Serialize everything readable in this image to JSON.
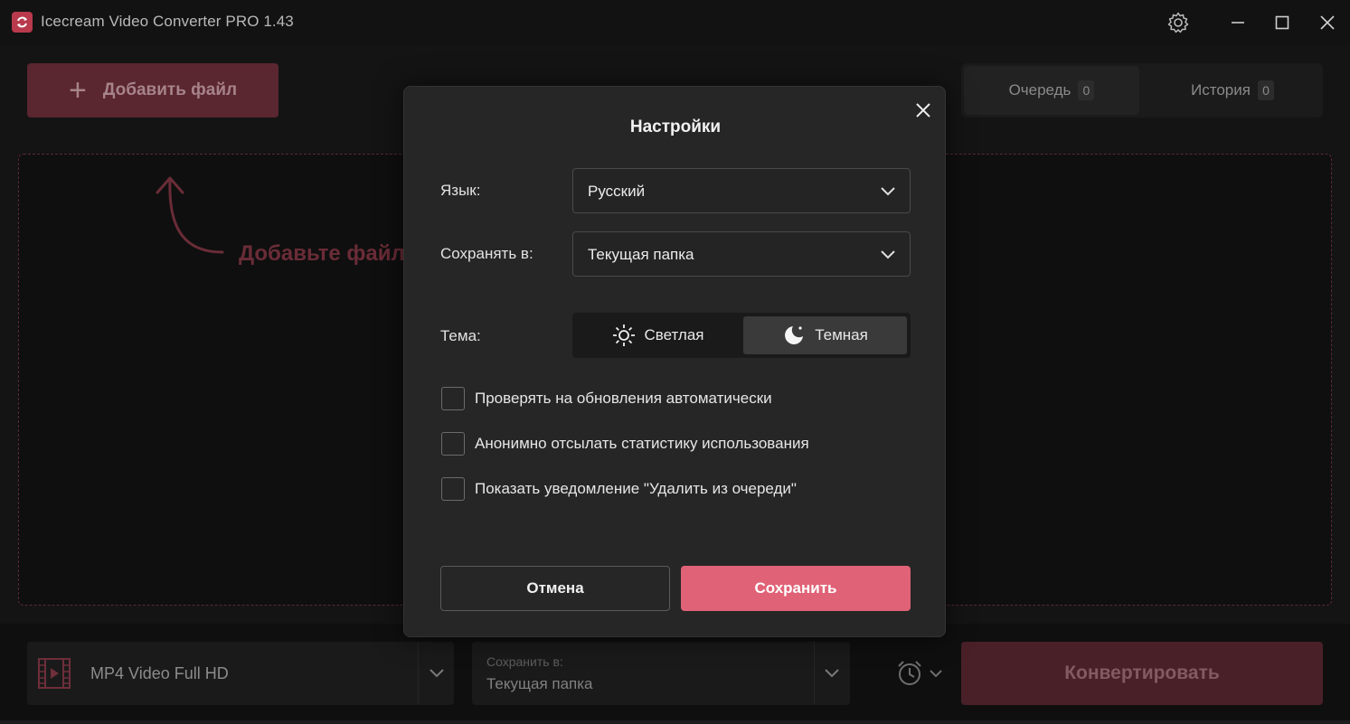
{
  "window": {
    "title": "Icecream Video Converter PRO 1.43"
  },
  "toolbar": {
    "add_file_label": "Добавить файл"
  },
  "tabs": [
    {
      "label": "Очередь",
      "count": "0"
    },
    {
      "label": "История",
      "count": "0"
    }
  ],
  "dropzone": {
    "hint": "Добавьте файлы"
  },
  "bottom": {
    "format_name": "MP4 Video Full HD",
    "save_caption": "Сохранить в:",
    "save_value": "Текущая папка",
    "convert_label": "Конвертировать"
  },
  "settings": {
    "title": "Настройки",
    "language_label": "Язык:",
    "language_value": "Русский",
    "save_to_label": "Сохранять в:",
    "save_to_value": "Текущая папка",
    "theme_label": "Тема:",
    "theme_light": "Светлая",
    "theme_dark": "Темная",
    "theme_selected": "Темная",
    "checkboxes": [
      {
        "label": "Проверять на обновления автоматически",
        "checked": false
      },
      {
        "label": "Анонимно отсылать статистику использования",
        "checked": false
      },
      {
        "label": "Показать уведомление \"Удалить из очереди\"",
        "checked": false
      }
    ],
    "cancel_label": "Отмена",
    "save_label": "Сохранить"
  },
  "colors": {
    "accent": "#e06276",
    "accent_dim": "#5a2630",
    "modal_bg": "#262626",
    "app_bg": "#141414"
  },
  "icons": [
    "app-logo-icon",
    "settings-gear-icon",
    "minimize-icon",
    "maximize-icon",
    "close-icon",
    "plus-icon",
    "curved-arrow-icon",
    "film-icon",
    "chevron-down-icon",
    "alarm-clock-icon",
    "sun-icon",
    "moon-icon"
  ]
}
